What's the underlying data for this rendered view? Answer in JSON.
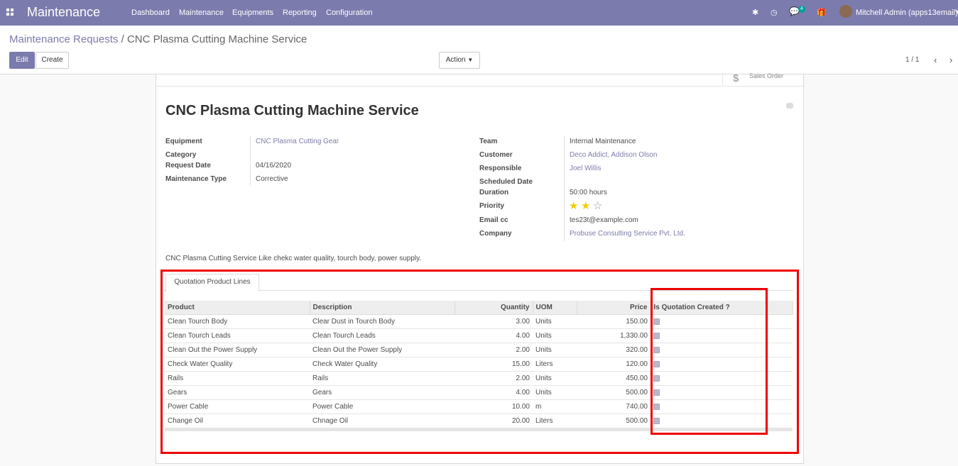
{
  "navbar": {
    "app_name": "Maintenance",
    "menu": [
      "Dashboard",
      "Maintenance",
      "Equipments",
      "Reporting",
      "Configuration"
    ],
    "messages_count": "4",
    "user_label": "Mitchell Admin (apps13email)"
  },
  "breadcrumb": {
    "parent": "Maintenance Requests",
    "separator": "/",
    "current": "CNC Plasma Cutting Machine Service"
  },
  "buttons": {
    "edit": "Edit",
    "create": "Create",
    "action": "Action"
  },
  "pager": {
    "value": "1 / 1"
  },
  "smart_button": {
    "label": "Sales Order"
  },
  "record": {
    "title": "CNC Plasma Cutting Machine Service",
    "left_fields": [
      {
        "label": "Equipment",
        "value": "CNC Plasma Cutting Gear"
      },
      {
        "label": "Category",
        "value": ""
      },
      {
        "label": "Request Date",
        "value": "04/16/2020"
      },
      {
        "label": "Maintenance Type",
        "value": "Corrective"
      }
    ],
    "right_fields": [
      {
        "label": "Team",
        "value": "Internal Maintenance"
      },
      {
        "label": "Customer",
        "value": "Deco Addict, Addison Olson"
      },
      {
        "label": "Responsible",
        "value": "Joel Willis"
      },
      {
        "label": "Scheduled Date",
        "value": ""
      },
      {
        "label": "Duration",
        "value": "50:00  hours"
      },
      {
        "label": "Priority",
        "value": ""
      },
      {
        "label": "Email cc",
        "value": "tes23t@example.com"
      },
      {
        "label": "Company",
        "value": "Probuse Consulting Service Pvt. Ltd."
      }
    ],
    "priority_stars": 2,
    "priority_max": 3,
    "description": "CNC Plasma Cutting Service Like chekc water quality, tourch body, power supply."
  },
  "notebook": {
    "tab_label": "Quotation Product Lines",
    "columns": [
      "Product",
      "Description",
      "Quantity",
      "UOM",
      "Price",
      "Is Quotation Created ?"
    ],
    "rows": [
      {
        "product": "Clean Tourch Body",
        "description": "Clear Dust in Tourch Body",
        "quantity": "3.00",
        "uom": "Units",
        "price": "150.00",
        "quotation_created": true
      },
      {
        "product": "Clean Tourch Leads",
        "description": "Clean Tourch Leads",
        "quantity": "4.00",
        "uom": "Units",
        "price": "1,330.00",
        "quotation_created": true
      },
      {
        "product": "Clean Out the Power Supply",
        "description": "Clean Out the Power Supply",
        "quantity": "2.00",
        "uom": "Units",
        "price": "320.00",
        "quotation_created": true
      },
      {
        "product": "Check Water Quality",
        "description": "Check Water Quality",
        "quantity": "15.00",
        "uom": "Liters",
        "price": "120.00",
        "quotation_created": true
      },
      {
        "product": "Rails",
        "description": "Rails",
        "quantity": "2.00",
        "uom": "Units",
        "price": "450.00",
        "quotation_created": true
      },
      {
        "product": "Gears",
        "description": "Gears",
        "quantity": "4.00",
        "uom": "Units",
        "price": "500.00",
        "quotation_created": true
      },
      {
        "product": "Power Cable",
        "description": "Power Cable",
        "quantity": "10.00",
        "uom": "m",
        "price": "740.00",
        "quotation_created": true
      },
      {
        "product": "Change Oil",
        "description": "Chnage Oil",
        "quantity": "20.00",
        "uom": "Liters",
        "price": "500.00",
        "quotation_created": true
      }
    ]
  },
  "colors": {
    "brand": "#7c7bad",
    "highlight": "#ee0000",
    "star": "#f3cc00"
  }
}
